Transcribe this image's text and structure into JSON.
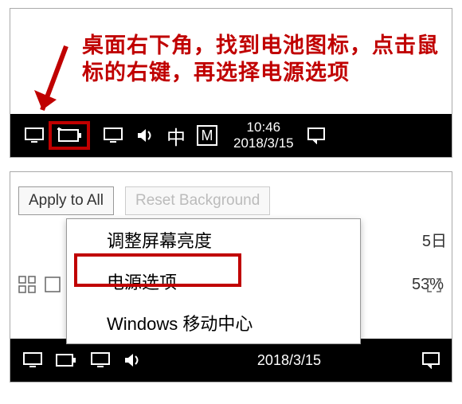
{
  "instruction_text": "桌面右下角，找到电池图标，点击鼠标的右键，再选择电源选项",
  "taskbar_top": {
    "ime_chinese": "中",
    "ime_mode": "M",
    "time": "10:46",
    "date": "2018/3/15"
  },
  "toolbar": {
    "apply_all": "Apply to All",
    "reset_bg": "Reset Background"
  },
  "context_menu": {
    "item_brightness": "调整屏幕亮度",
    "item_power": "电源选项",
    "item_mobility": "Windows 移动中心"
  },
  "bg_date_fragment": "5日",
  "bg_percent": "53%",
  "taskbar_bottom": {
    "date": "2018/3/15"
  }
}
